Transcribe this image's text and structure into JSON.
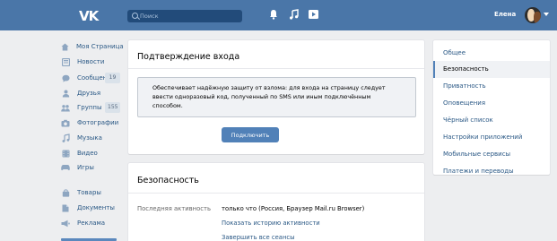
{
  "header": {
    "logo": "VK",
    "search_placeholder": "Поиск",
    "username": "Елена"
  },
  "nav": {
    "items": [
      {
        "label": "Моя Страница",
        "icon": "home-icon"
      },
      {
        "label": "Новости",
        "icon": "news-icon"
      },
      {
        "label": "Сообщения",
        "icon": "messages-icon",
        "count": "19"
      },
      {
        "label": "Друзья",
        "icon": "friends-icon"
      },
      {
        "label": "Группы",
        "icon": "groups-icon",
        "count": "155"
      },
      {
        "label": "Фотографии",
        "icon": "camera-icon"
      },
      {
        "label": "Музыка",
        "icon": "music-icon"
      },
      {
        "label": "Видео",
        "icon": "video-icon"
      },
      {
        "label": "Игры",
        "icon": "games-icon"
      },
      {
        "label": "Товары",
        "icon": "goods-icon"
      },
      {
        "label": "Документы",
        "icon": "documents-icon"
      },
      {
        "label": "Реклама",
        "icon": "ads-icon"
      }
    ]
  },
  "confirm": {
    "title": "Подтверждение входа",
    "notice": "Обеспечивает надёжную защиту от взлома: для входа на страницу следует ввести одноразовый код, полученный по SMS или иным подключённым способом.",
    "button": "Подключить"
  },
  "security": {
    "title": "Безопасность",
    "last_activity_label": "Последняя активность",
    "last_activity_value": "только что (Россия, Браузер Mail.ru Browser)",
    "show_history_link": "Показать историю активности",
    "end_sessions_link": "Завершить все сеансы"
  },
  "settings_menu": {
    "items": [
      {
        "label": "Общее",
        "active": false
      },
      {
        "label": "Безопасность",
        "active": true
      },
      {
        "label": "Приватность",
        "active": false
      },
      {
        "label": "Оповещения",
        "active": false
      },
      {
        "label": "Чёрный список",
        "active": false
      },
      {
        "label": "Настройки приложений",
        "active": false
      },
      {
        "label": "Мобильные сервисы",
        "active": false
      },
      {
        "label": "Платежи и переводы",
        "active": false
      }
    ]
  }
}
